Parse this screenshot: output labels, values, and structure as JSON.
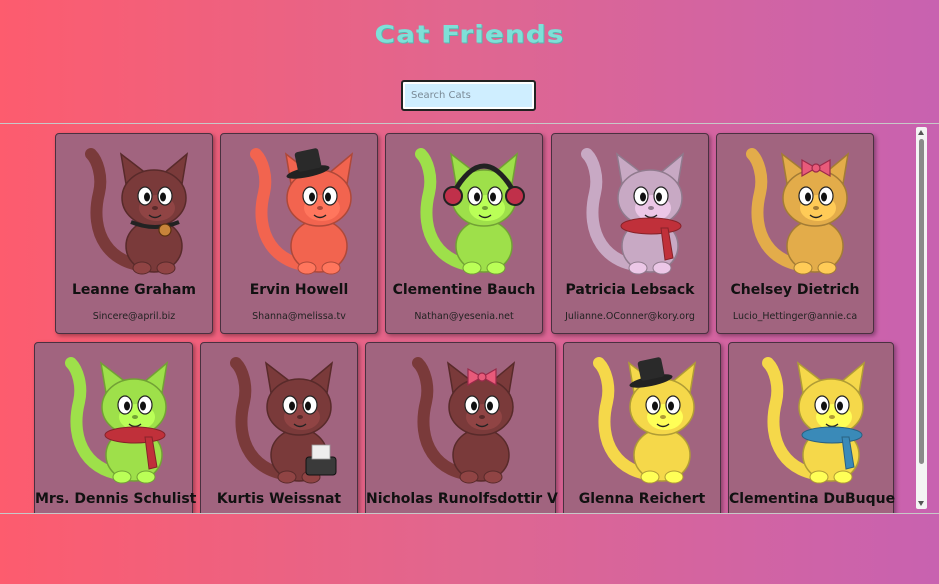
{
  "app": {
    "title": "Cat Friends"
  },
  "search": {
    "placeholder": "Search Cats"
  },
  "cats": [
    {
      "name": "Leanne Graham",
      "email": "Sincere@april.biz",
      "color": "#7a3a3a",
      "accessory": "collar"
    },
    {
      "name": "Ervin Howell",
      "email": "Shanna@melissa.tv",
      "color": "#f2644f",
      "accessory": "top-hat"
    },
    {
      "name": "Clementine Bauch",
      "email": "Nathan@yesenia.net",
      "color": "#9ee04a",
      "accessory": "headphones"
    },
    {
      "name": "Patricia Lebsack",
      "email": "Julianne.OConner@kory.org",
      "color": "#c8a9c4",
      "accessory": "scarf"
    },
    {
      "name": "Chelsey Dietrich",
      "email": "Lucio_Hettinger@annie.ca",
      "color": "#e3ac4a",
      "accessory": "bow"
    },
    {
      "name": "Mrs. Dennis Schulist",
      "color": "#9ee04a",
      "accessory": "scarf"
    },
    {
      "name": "Kurtis Weissnat",
      "color": "#7a3a3a",
      "accessory": "typewriter"
    },
    {
      "name": "Nicholas Runolfsdottir V",
      "color": "#7a3a3a",
      "accessory": "bow"
    },
    {
      "name": "Glenna Reichert",
      "color": "#f5d84a",
      "accessory": "top-hat"
    },
    {
      "name": "Clementina DuBuque",
      "color": "#f5d84a",
      "accessory": "blue-scarf"
    }
  ]
}
